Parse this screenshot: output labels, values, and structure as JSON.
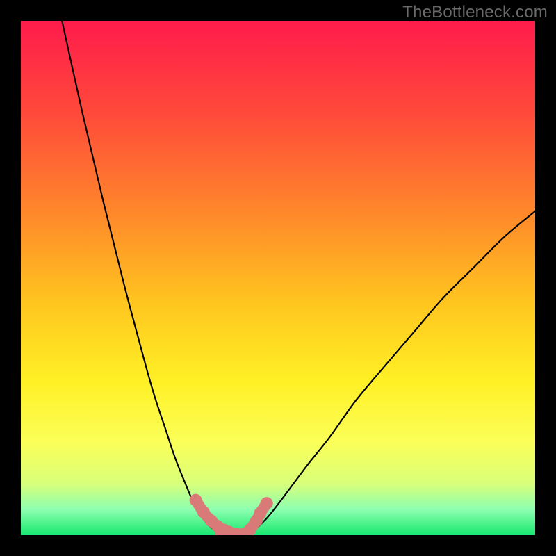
{
  "watermark": "TheBottleneck.com",
  "chart_data": {
    "type": "line",
    "title": "",
    "xlabel": "",
    "ylabel": "",
    "xlim": [
      0,
      100
    ],
    "ylim": [
      0,
      100
    ],
    "grid": false,
    "series": [
      {
        "name": "curve-left",
        "x": [
          8,
          12,
          16,
          20,
          24,
          26,
          28,
          30,
          32,
          33.5,
          35,
          36,
          37,
          38,
          38.5
        ],
        "y": [
          100,
          82,
          65,
          49,
          34,
          27,
          21,
          15,
          10,
          6.5,
          4,
          2.5,
          1.5,
          0.7,
          0.3
        ]
      },
      {
        "name": "curve-right",
        "x": [
          44.5,
          46,
          48,
          50,
          53,
          56,
          60,
          65,
          70,
          76,
          82,
          88,
          94,
          100
        ],
        "y": [
          0.3,
          1.5,
          3.5,
          6,
          10,
          14,
          19,
          26,
          32,
          39,
          46,
          52,
          58,
          63
        ]
      },
      {
        "name": "markers-left",
        "x": [
          34,
          35.5,
          37,
          38.3,
          39.5,
          40.5
        ],
        "y": [
          6.8,
          4.5,
          2.8,
          1.7,
          1.0,
          0.6
        ]
      },
      {
        "name": "markers-flat",
        "x": [
          39,
          40.5,
          42,
          43.5
        ],
        "y": [
          0.25,
          0.2,
          0.2,
          0.25
        ]
      },
      {
        "name": "markers-right",
        "x": [
          44.5,
          45.8,
          46.5,
          47.8
        ],
        "y": [
          1.0,
          2.8,
          4.2,
          6.2
        ]
      }
    ],
    "background_gradient": {
      "stops": [
        {
          "offset": 0.0,
          "color": "#ff1b4b"
        },
        {
          "offset": 0.18,
          "color": "#ff4a3a"
        },
        {
          "offset": 0.38,
          "color": "#ff8a2a"
        },
        {
          "offset": 0.55,
          "color": "#ffc61f"
        },
        {
          "offset": 0.7,
          "color": "#fff025"
        },
        {
          "offset": 0.82,
          "color": "#fbff58"
        },
        {
          "offset": 0.9,
          "color": "#d8ff7a"
        },
        {
          "offset": 0.95,
          "color": "#8dffb0"
        },
        {
          "offset": 1.0,
          "color": "#17e86f"
        }
      ]
    },
    "marker_color": "#d97a78",
    "curve_color": "#000000"
  }
}
